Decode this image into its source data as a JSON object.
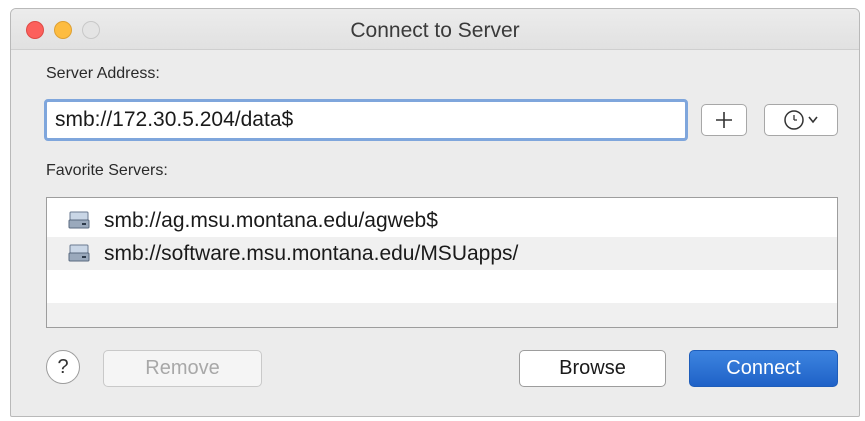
{
  "window": {
    "title": "Connect to Server"
  },
  "server_address": {
    "label": "Server Address:",
    "value": "smb://172.30.5.204/data$"
  },
  "toolbar": {
    "add_favorite_symbol": "+",
    "recent_servers_icon": "clock-icon"
  },
  "favorites": {
    "label": "Favorite Servers:",
    "items": [
      {
        "label": "smb://ag.msu.montana.edu/agweb$",
        "icon": "network-drive-icon"
      },
      {
        "label": "smb://software.msu.montana.edu/MSUapps/",
        "icon": "network-drive-icon"
      }
    ]
  },
  "buttons": {
    "help_symbol": "?",
    "remove_label": "Remove",
    "browse_label": "Browse",
    "connect_label": "Connect"
  },
  "colors": {
    "accent": "#1f62c7",
    "focus_ring": "#7fa6dc",
    "close": "#fc605c",
    "minimize": "#fdbc40"
  }
}
